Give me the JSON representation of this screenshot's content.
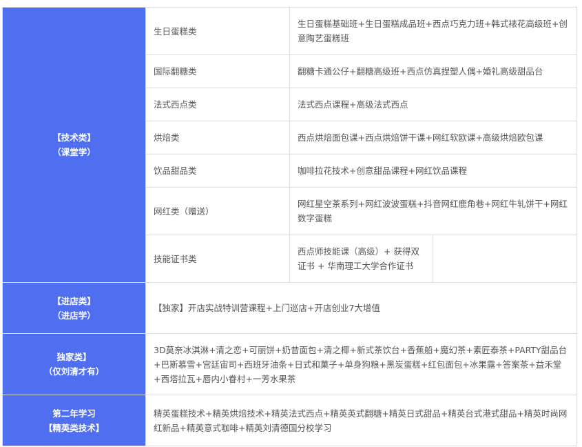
{
  "groups": {
    "tech": {
      "line1": "【技术类】",
      "line2": "（课堂学）",
      "rows": [
        {
          "sub": "生日蛋糕类",
          "detail": "生日蛋糕基础班+生日蛋糕成品班+西点巧克力班+韩式裱花高级班+创意陶艺蛋糕班"
        },
        {
          "sub": "国际翻糖类",
          "detail": "翻糖卡通公仔+翻糖高级班+西点仿真捏塑人偶+婚礼高级甜品台"
        },
        {
          "sub": "法式西点类",
          "detail": "法式西点课程+高级法式西点"
        },
        {
          "sub": "烘焙类",
          "detail": "西点烘焙面包课+西点烘焙饼干课+网红软欧课+高级烘焙欧包课"
        },
        {
          "sub": "饮品甜品类",
          "detail": "咖啡拉花技术+创意甜品课程+网红饮品课程"
        },
        {
          "sub": "网红类（赠送）",
          "detail": "网红星空茶系列+网红波波蛋糕+抖音网红鹿角巷+网红牛轧饼干+网红数字蛋糕"
        },
        {
          "sub": "技能证书类",
          "detail": "西点师技能课（高级）+ 获得双证书 + 华南理工大学合作证书"
        }
      ]
    },
    "store": {
      "line1": "【进店类】",
      "line2": "（进店学）",
      "detail": "【独家】开店实战特训营课程+上门巡店+开店创业7大增值"
    },
    "exclusive": {
      "line1": "独家类】",
      "line2": "（仅刘清才有）",
      "detail": "3D莫奈冰淇淋+清之恋+可丽饼+奶昔面包+清之椰+新式茶饮台+香蕉船+魔幻茶+素匠泰茶+PARTY甜品台+巴斯慕雪+宫廷宙司+西班牙油条+日式和菓子+单身狗粮+黑炭蛋糕+红包面包+冰果露+答案茶+益禾堂+西塔拉瓦+唇内小眷村+一芳水果茶"
    },
    "elite": {
      "line1": "第二年学习",
      "line2": "【精英类技术】",
      "detail": "精英蛋糕技术+精英烘焙技术+精英法式西点+精英英式翻糖+精英日式甜品+精英台式港式甜品+精英时尚网红新品+精英意式咖啡+精英刘清德国分校学习"
    }
  },
  "colors": {
    "category_bg": "#4f6ef0",
    "category_text": "#ffffff",
    "body_text": "#555555",
    "border": "#dddddd"
  }
}
